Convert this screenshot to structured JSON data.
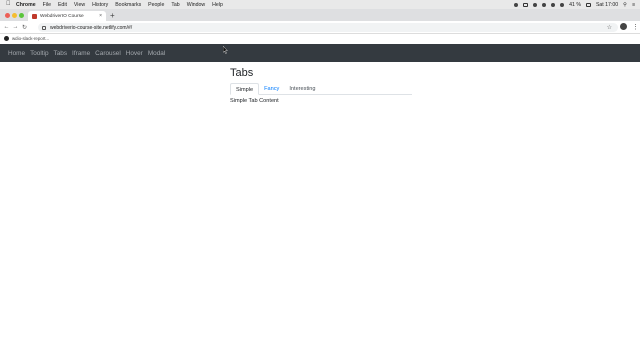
{
  "menubar": {
    "app": "Chrome",
    "items": [
      "File",
      "Edit",
      "View",
      "History",
      "Bookmarks",
      "People",
      "Tab",
      "Window",
      "Help"
    ],
    "battery": "41 %",
    "clock": "Sat 17:00"
  },
  "browser": {
    "tab_title": "WebdriverIO Course",
    "url": "webdriverio-course-site.netlify.com/#/",
    "bookmark": "wdio-slack-report..."
  },
  "site": {
    "nav": [
      "Home",
      "Tooltip",
      "Tabs",
      "Iframe",
      "Carousel",
      "Hover",
      "Modal"
    ],
    "title": "Tabs",
    "tabs": [
      "Simple",
      "Fancy",
      "Interesting"
    ],
    "content": "Simple Tab Content"
  },
  "colors": {
    "navbar": "#343a40",
    "link": "#007bff",
    "favicon": "#c0392b"
  }
}
